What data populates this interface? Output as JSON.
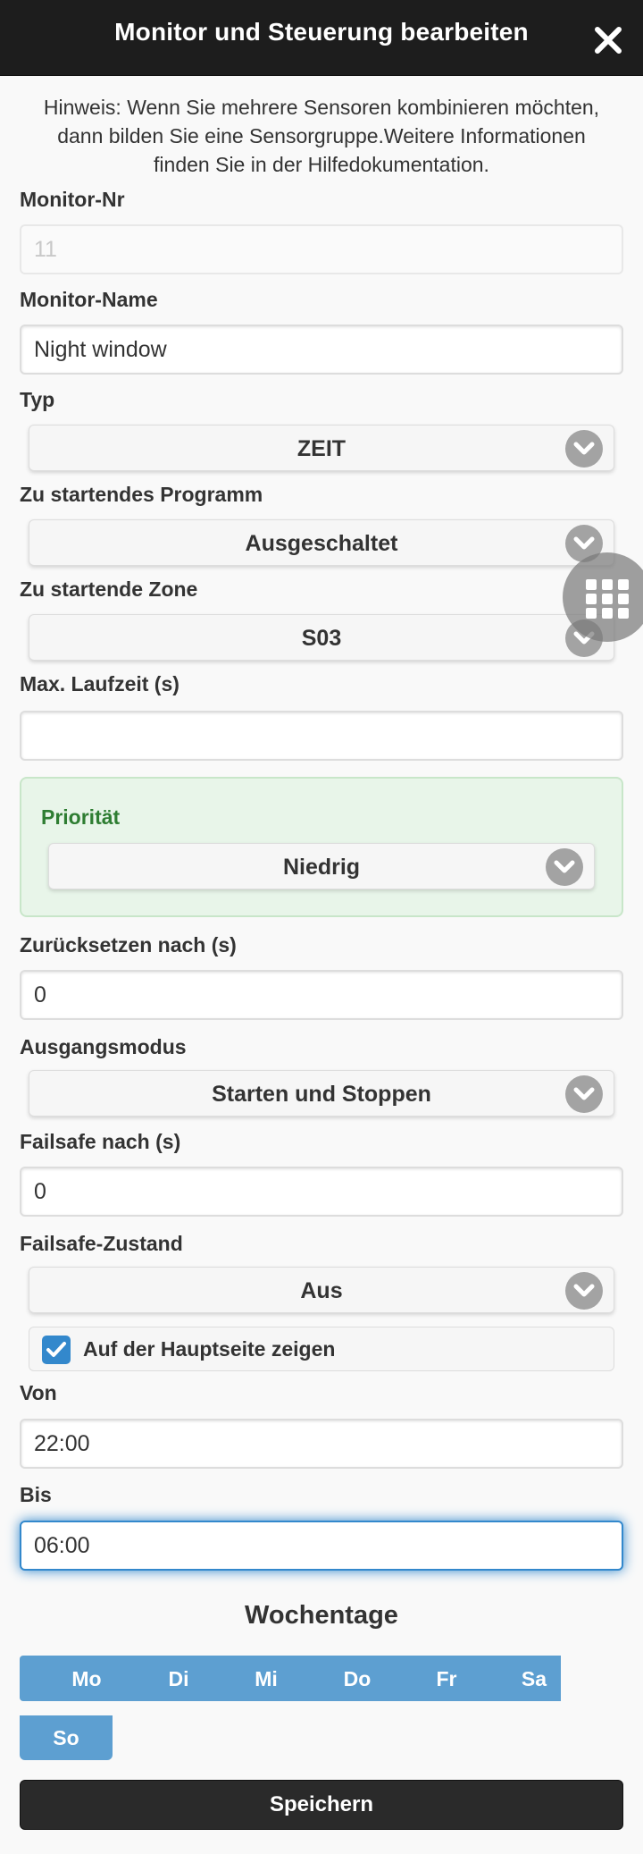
{
  "header": {
    "title": "Monitor und Steuerung bearbeiten",
    "close_icon": "close-icon"
  },
  "hint": "Hinweis: Wenn Sie mehrere Sensoren kombinieren möchten, dann bilden Sie eine Sensorgruppe.Weitere Informationen finden Sie in der Hilfedokumentation.",
  "fields": {
    "monitor_nr": {
      "label": "Monitor-Nr",
      "value": "11"
    },
    "monitor_name": {
      "label": "Monitor-Name",
      "value": "Night window"
    },
    "typ": {
      "label": "Typ",
      "value": "ZEIT"
    },
    "programm": {
      "label": "Zu startendes Programm",
      "value": "Ausgeschaltet"
    },
    "zone": {
      "label": "Zu startende Zone",
      "value": "S03"
    },
    "max_laufzeit": {
      "label": "Max. Laufzeit (s)",
      "value": ""
    },
    "prioritaet": {
      "label": "Priorität",
      "value": "Niedrig"
    },
    "zuruecksetzen": {
      "label": "Zurücksetzen nach (s)",
      "value": "0"
    },
    "ausgangsmodus": {
      "label": "Ausgangsmodus",
      "value": "Starten und Stoppen"
    },
    "failsafe_nach": {
      "label": "Failsafe nach (s)",
      "value": "0"
    },
    "failsafe_zustand": {
      "label": "Failsafe-Zustand",
      "value": "Aus"
    },
    "hauptseite": {
      "label": "Auf der Hauptseite zeigen",
      "checked": true
    },
    "von": {
      "label": "Von",
      "value": "22:00"
    },
    "bis": {
      "label": "Bis",
      "value": "06:00"
    }
  },
  "weekdays": {
    "title": "Wochentage",
    "days": [
      "Mo",
      "Di",
      "Mi",
      "Do",
      "Fr",
      "Sa",
      "So"
    ]
  },
  "save_label": "Speichern",
  "colors": {
    "header_bg": "#1d1d1d",
    "accent": "#3388cc",
    "day_selected": "#5d9fd1",
    "priority_bg": "#e8f5e9",
    "priority_text": "#2e7d32"
  },
  "icons": {
    "chevron": "chevron-down-icon",
    "checkbox": "checkmark-icon",
    "grid": "grid-menu-icon"
  }
}
